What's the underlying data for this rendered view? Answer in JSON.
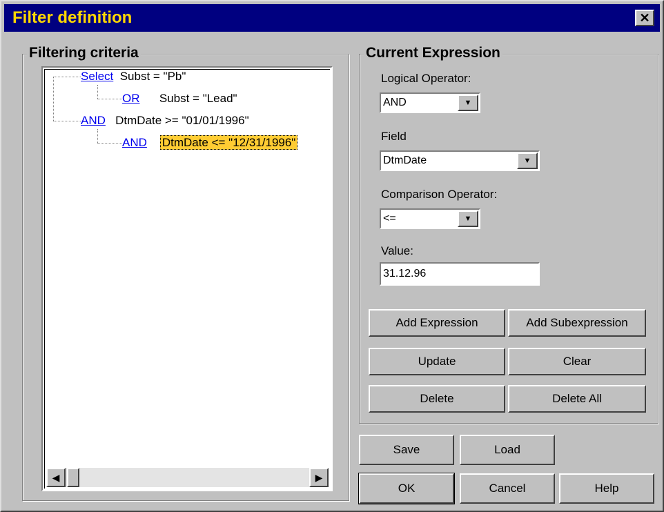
{
  "window": {
    "title": "Filter definition",
    "close_glyph": "✕"
  },
  "criteria": {
    "group_label": "Filtering criteria",
    "nodes": [
      {
        "op": "Select",
        "expr": "Subst = \"Pb\""
      },
      {
        "op": "OR",
        "expr": "Subst = \"Lead\""
      },
      {
        "op": "AND",
        "expr": "DtmDate >= \"01/01/1996\""
      },
      {
        "op": "AND",
        "expr": "DtmDate <= \"12/31/1996\""
      }
    ],
    "selected_index": 3,
    "scroll_left_glyph": "◀",
    "scroll_right_glyph": "▶"
  },
  "expression": {
    "group_label": "Current Expression",
    "logical_operator": {
      "label": "Logical Operator:",
      "value": "AND"
    },
    "field": {
      "label": "Field",
      "value": "DtmDate"
    },
    "comparison_operator": {
      "label": "Comparison Operator:",
      "value": "<="
    },
    "value": {
      "label": "Value:",
      "value": "31.12.96"
    },
    "dropdown_glyph": "▼",
    "buttons": {
      "add_expression": "Add Expression",
      "add_subexpression": "Add Subexpression",
      "update": "Update",
      "clear": "Clear",
      "delete": "Delete",
      "delete_all": "Delete All"
    }
  },
  "footer": {
    "save": "Save",
    "load": "Load",
    "ok": "OK",
    "cancel": "Cancel",
    "help": "Help"
  },
  "colors": {
    "title_bg": "#000080",
    "title_fg": "#ffd700",
    "selected_bg": "#ffcc33",
    "link": "#0000ee"
  }
}
